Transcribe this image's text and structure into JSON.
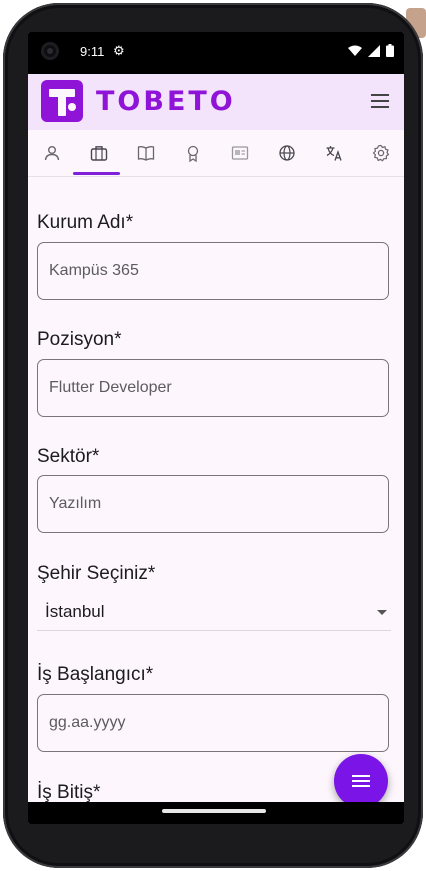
{
  "status_bar": {
    "time": "9:11"
  },
  "app_bar": {
    "logo_text": "TOBETO",
    "brand_color": "#8f14d7"
  },
  "tabs": [
    {
      "icon": "person-icon",
      "active": false
    },
    {
      "icon": "briefcase-icon",
      "active": true
    },
    {
      "icon": "book-icon",
      "active": false
    },
    {
      "icon": "award-icon",
      "active": false
    },
    {
      "icon": "certificate-icon",
      "active": false
    },
    {
      "icon": "globe-icon",
      "active": false
    },
    {
      "icon": "translate-icon",
      "active": false
    },
    {
      "icon": "settings-icon",
      "active": false
    }
  ],
  "form": {
    "institution": {
      "label": "Kurum Adı*",
      "placeholder": "Kampüs 365"
    },
    "position": {
      "label": "Pozisyon*",
      "placeholder": "Flutter Developer"
    },
    "sector": {
      "label": "Sektör*",
      "placeholder": "Yazılım"
    },
    "city": {
      "label": "Şehir Seçiniz*",
      "selected": "İstanbul"
    },
    "start_date": {
      "label": "İş Başlangıcı*",
      "placeholder": "gg.aa.yyyy"
    },
    "end_date": {
      "label": "İş Bitiş*"
    }
  },
  "fab": {
    "icon": "menu-icon",
    "color": "#7b14e6"
  }
}
